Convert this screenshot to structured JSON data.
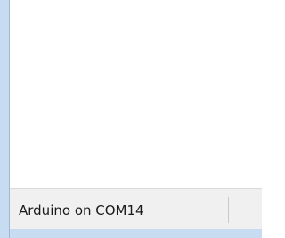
{
  "status_bar": {
    "board_port": "Arduino on COM14"
  }
}
